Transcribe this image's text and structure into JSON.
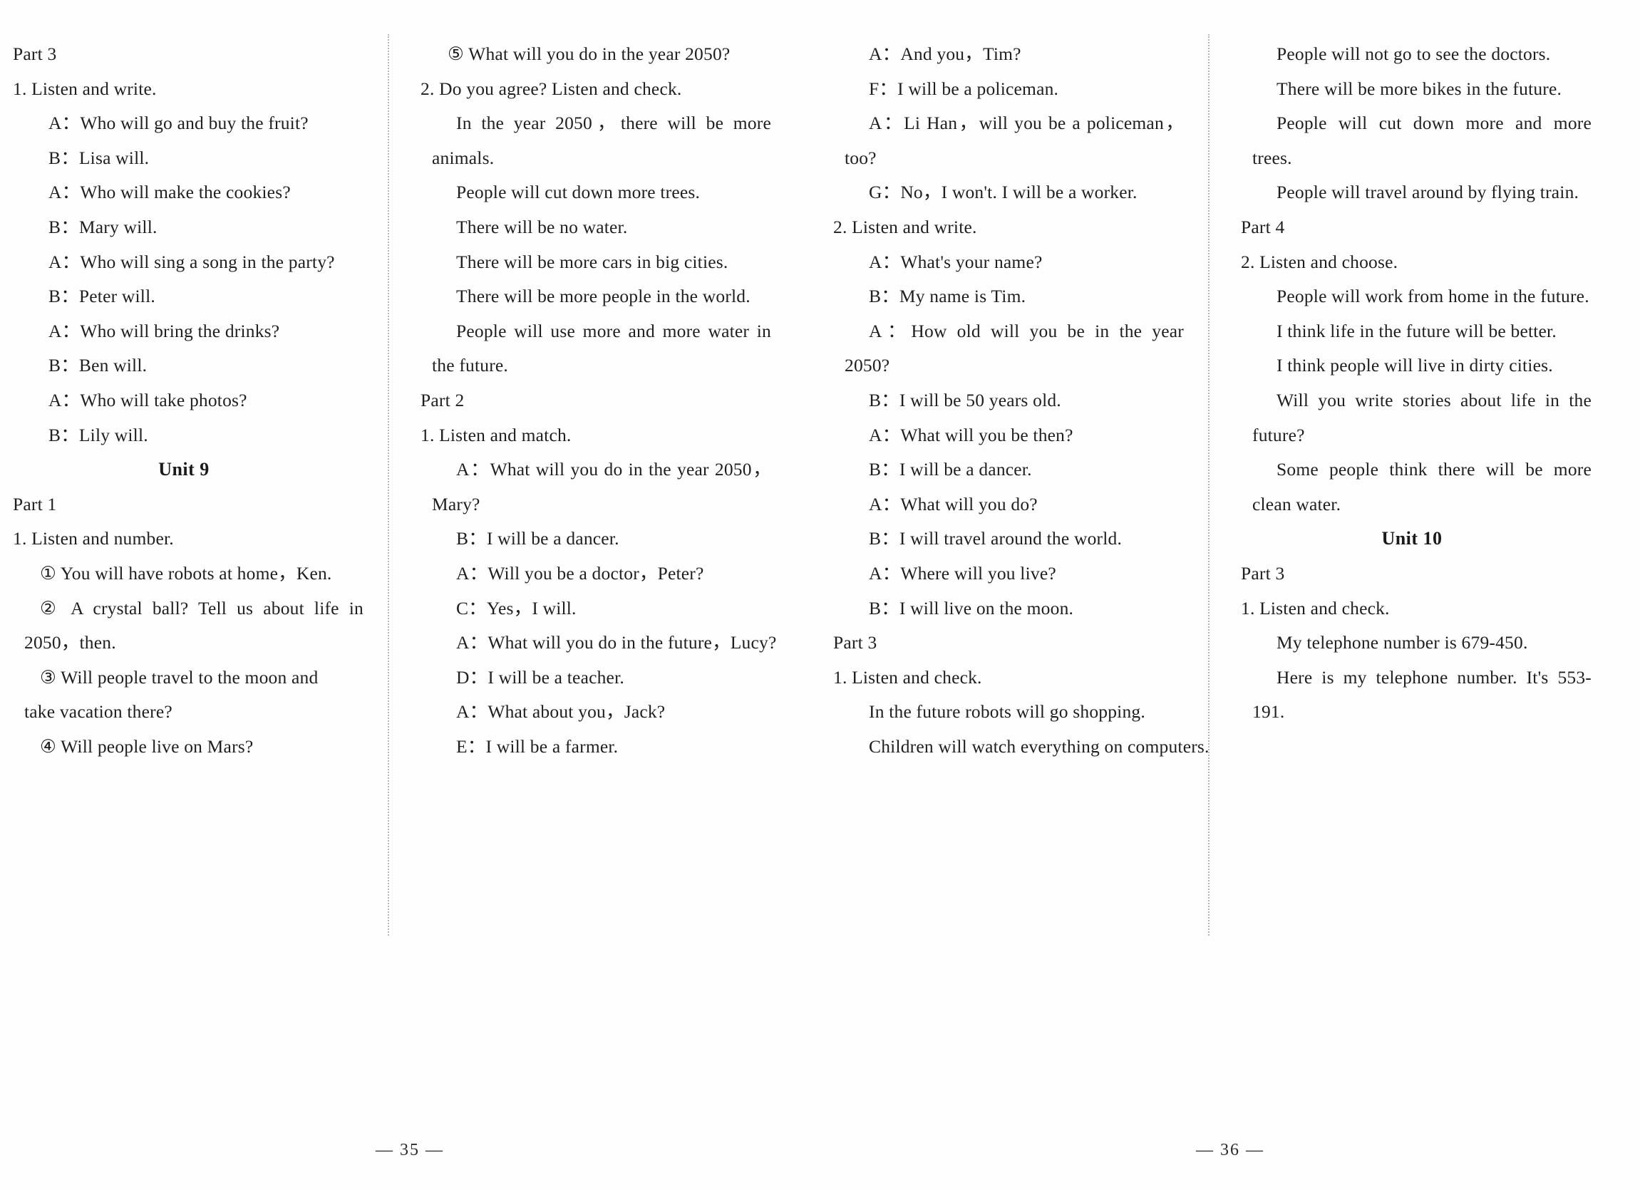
{
  "document": {
    "type": "textbook-listening-script",
    "spread": "two-page",
    "pages": [
      {
        "number_label": "— 35 —"
      },
      {
        "number_label": "— 36 —"
      }
    ]
  },
  "columns": [
    {
      "id": "col-1",
      "lines": [
        {
          "level": "head",
          "text": "Part 3"
        },
        {
          "level": "num",
          "text": "1. Listen and write."
        },
        {
          "level": "body",
          "text": "A：Who will go and buy the fruit?"
        },
        {
          "level": "body",
          "text": "B：Lisa will."
        },
        {
          "level": "body",
          "text": "A：Who will make the cookies?"
        },
        {
          "level": "body",
          "text": "B：Mary will."
        },
        {
          "level": "body",
          "text": "A：Who will sing a song in the party?"
        },
        {
          "level": "body",
          "text": "B：Peter will."
        },
        {
          "level": "body",
          "text": "A：Who will bring the drinks?"
        },
        {
          "level": "body",
          "text": "B：Ben will."
        },
        {
          "level": "body",
          "text": "A：Who will take photos?"
        },
        {
          "level": "body",
          "text": "B：Lily will."
        },
        {
          "level": "unit",
          "text": "Unit 9"
        },
        {
          "level": "head",
          "text": "Part 1"
        },
        {
          "level": "num",
          "text": "1. Listen and number."
        },
        {
          "level": "item",
          "text": "① You will have robots at home，Ken."
        },
        {
          "level": "item_just",
          "text": "② A crystal ball? Tell us about life in"
        },
        {
          "level": "cont",
          "text": "2050，then."
        },
        {
          "level": "item",
          "text": "③ Will people travel to the moon and"
        },
        {
          "level": "cont",
          "text": "take vacation there?"
        },
        {
          "level": "item",
          "text": "④ Will people live on Mars?"
        }
      ]
    },
    {
      "id": "col-2",
      "lines": [
        {
          "level": "item",
          "text": "⑤ What will you do in the year 2050?"
        },
        {
          "level": "num",
          "text": "2. Do you agree? Listen and check."
        },
        {
          "level": "body_just",
          "text": "In the year 2050，there will be more"
        },
        {
          "level": "cont",
          "text": "animals."
        },
        {
          "level": "body",
          "text": "People will cut down more trees."
        },
        {
          "level": "body",
          "text": "There will be no water."
        },
        {
          "level": "body",
          "text": "There will be more cars in big cities."
        },
        {
          "level": "body",
          "text": "There will be more people in the world."
        },
        {
          "level": "body_just",
          "text": "People will use more and more water in"
        },
        {
          "level": "cont",
          "text": "the future."
        },
        {
          "level": "head",
          "text": "Part 2"
        },
        {
          "level": "num",
          "text": "1. Listen and match."
        },
        {
          "level": "body_just",
          "text": "A：What will you do in the year 2050，"
        },
        {
          "level": "cont",
          "text": "Mary?"
        },
        {
          "level": "body",
          "text": "B：I will be a dancer."
        },
        {
          "level": "body",
          "text": "A：Will you be a doctor，Peter?"
        },
        {
          "level": "body",
          "text": "C：Yes，I will."
        },
        {
          "level": "body",
          "text": "A：What will you do in the future，Lucy?"
        },
        {
          "level": "body",
          "text": "D：I will be a teacher."
        },
        {
          "level": "body",
          "text": "A：What about you，Jack?"
        },
        {
          "level": "body",
          "text": "E：I will be a farmer."
        }
      ]
    },
    {
      "id": "col-3",
      "lines": [
        {
          "level": "body",
          "text": "A：And you，Tim?"
        },
        {
          "level": "body",
          "text": "F：I will be a policeman."
        },
        {
          "level": "body_just",
          "text": "A：Li Han，will you be a policeman，"
        },
        {
          "level": "cont",
          "text": "too?"
        },
        {
          "level": "body",
          "text": "G：No，I won't. I will be a worker."
        },
        {
          "level": "num",
          "text": "2. Listen and write."
        },
        {
          "level": "body",
          "text": "A：What's your name?"
        },
        {
          "level": "body",
          "text": "B：My name is Tim."
        },
        {
          "level": "body_just",
          "text": "A：How old will you be in the year"
        },
        {
          "level": "cont",
          "text": "2050?"
        },
        {
          "level": "body",
          "text": "B：I will be 50 years old."
        },
        {
          "level": "body",
          "text": "A：What will you be then?"
        },
        {
          "level": "body",
          "text": "B：I will be a dancer."
        },
        {
          "level": "body",
          "text": "A：What will you do?"
        },
        {
          "level": "body",
          "text": "B：I will travel around the world."
        },
        {
          "level": "body",
          "text": "A：Where will you live?"
        },
        {
          "level": "body",
          "text": "B：I will live on the moon."
        },
        {
          "level": "head",
          "text": "Part 3"
        },
        {
          "level": "num",
          "text": "1. Listen and check."
        },
        {
          "level": "body",
          "text": "In the future robots will go shopping."
        },
        {
          "level": "body",
          "text": "Children will watch everything on computers."
        }
      ]
    },
    {
      "id": "col-4",
      "lines": [
        {
          "level": "body",
          "text": "People will not go to see the doctors."
        },
        {
          "level": "body",
          "text": "There will be more bikes in the future."
        },
        {
          "level": "body_just",
          "text": "People will cut down more and more"
        },
        {
          "level": "cont",
          "text": "trees."
        },
        {
          "level": "body",
          "text": "People will travel around by flying train."
        },
        {
          "level": "head",
          "text": "Part 4"
        },
        {
          "level": "num",
          "text": "2. Listen and choose."
        },
        {
          "level": "body",
          "text": "People will work from home in the future."
        },
        {
          "level": "body",
          "text": "I think life in the future will be better."
        },
        {
          "level": "body",
          "text": "I think people will live in dirty cities."
        },
        {
          "level": "body_just",
          "text": "Will you write stories about life in the"
        },
        {
          "level": "cont",
          "text": "future?"
        },
        {
          "level": "body_just",
          "text": "Some people think there will be more"
        },
        {
          "level": "cont",
          "text": "clean water."
        },
        {
          "level": "unit",
          "text": "Unit 10"
        },
        {
          "level": "head",
          "text": "Part 3"
        },
        {
          "level": "num",
          "text": "1. Listen and check."
        },
        {
          "level": "body",
          "text": "My telephone number is 679-450."
        },
        {
          "level": "body_just",
          "text": "Here is my telephone number. It's 553-"
        },
        {
          "level": "cont",
          "text": "191."
        }
      ]
    }
  ]
}
